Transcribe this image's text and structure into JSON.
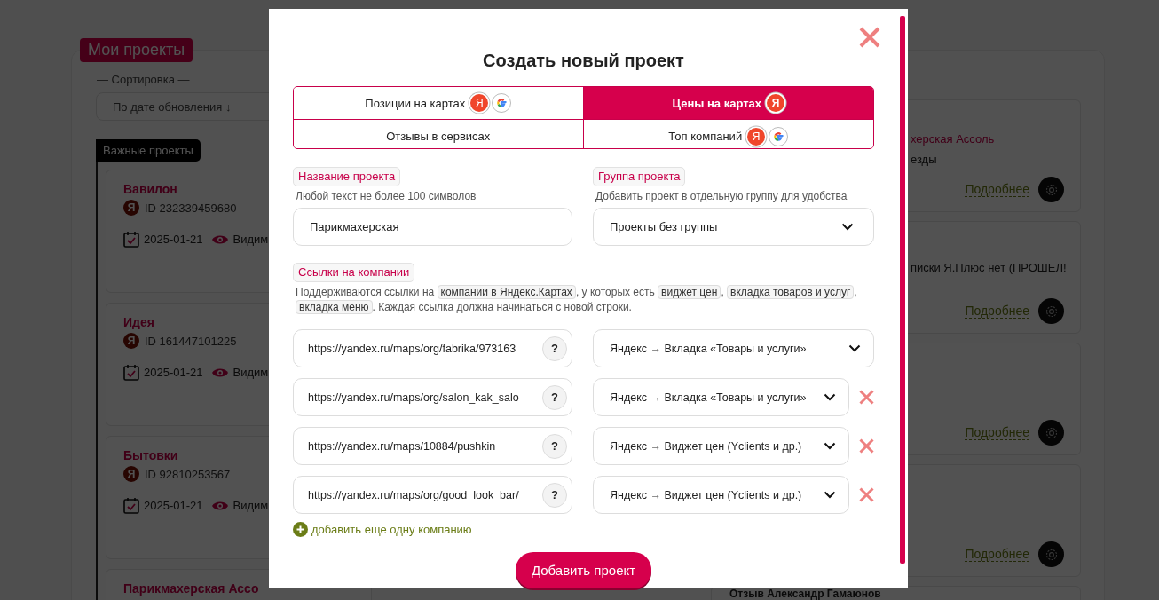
{
  "background": {
    "section_title": "Мои проекты",
    "sort_label": "— Сортировка —",
    "sort_value": "По дате обновления ↓",
    "important_label": "Важные проекты",
    "projects": [
      {
        "name": "Вавилон",
        "source_mark": "Я",
        "id": "ID 232339459680",
        "date": "2025-01-21",
        "visibility": "Видим"
      },
      {
        "name": "Идея",
        "source_mark": "Я",
        "id": "ID 161447101225",
        "date": "2025-01-21",
        "visibility": "Видим"
      },
      {
        "name": "Бытовки",
        "source_mark": "Я",
        "id": "ID 92810253567",
        "date": "2025-01-21",
        "visibility": "Видим"
      },
      {
        "name": "Парикмахерская Ассо"
      }
    ],
    "cards": [
      {
        "title": "херская Ассоль",
        "text": "езды",
        "link": "Подробнее"
      },
      {
        "text": "писки Я.Плюс нет (ПРОШЕЛ!",
        "link": "Подробнее"
      },
      {
        "link": "Подробнее"
      },
      {
        "link": "Подробнее"
      },
      {
        "title": "Отзыв Александр Гамаюнов"
      }
    ]
  },
  "dialog": {
    "title": "Создать новый проект",
    "tabs": [
      {
        "label": "Позиции на картах",
        "selected": false,
        "logos": [
          {
            "kind": "yandex",
            "mark": "Я"
          },
          {
            "kind": "google"
          }
        ]
      },
      {
        "label": "Цены на картах",
        "selected": true,
        "logos": [
          {
            "kind": "yandex",
            "mark": "Я"
          }
        ]
      },
      {
        "label": "Отзывы в сервисах",
        "selected": false
      },
      {
        "label": "Топ компаний",
        "selected": false,
        "logos": [
          {
            "kind": "yandex",
            "mark": "Я"
          },
          {
            "kind": "google"
          }
        ]
      }
    ],
    "name_field": {
      "label": "Название проекта",
      "hint": "Любой текст не более 100 символов",
      "value": "Парикмахерская"
    },
    "group_field": {
      "label": "Группа проекта",
      "hint": "Добавить проект в отдельную группу для удобства",
      "value": "Проекты без группы"
    },
    "links": {
      "label": "Ссылки на компании",
      "description": [
        {
          "text": "Поддерживаются ссылки на "
        },
        {
          "text": "компании в Яндекс.Картах",
          "chip": true
        },
        {
          "text": ", у которых есть "
        },
        {
          "text": "виджет цен",
          "chip": true
        },
        {
          "text": ", "
        },
        {
          "text": "вкладка товаров и услуг",
          "chip": true
        },
        {
          "text": ", "
        },
        {
          "text": "вкладка меню",
          "chip": true
        },
        {
          "text": ". Каждая ссылка должна начинаться с новой строки."
        }
      ],
      "rows": [
        {
          "url": "https://yandex.ru/maps/org/fabrika/973163",
          "help": "?",
          "source": "Яндекс → Вкладка «Товары и услуги»",
          "removable": false
        },
        {
          "url": "https://yandex.ru/maps/org/salon_kak_salo",
          "help": "?",
          "source": "Яндекс → Вкладка «Товары и услуги»",
          "removable": true
        },
        {
          "url": "https://yandex.ru/maps/10884/pushkin",
          "help": "?",
          "source": "Яндекс → Виджет цен (Yclients и др.)",
          "removable": true
        },
        {
          "url": "https://yandex.ru/maps/org/good_look_bar/",
          "help": "?",
          "source": "Яндекс → Виджет цен (Yclients и др.)",
          "removable": true
        }
      ],
      "add_label": "добавить еще одну компанию"
    },
    "submit": "Добавить проект"
  }
}
